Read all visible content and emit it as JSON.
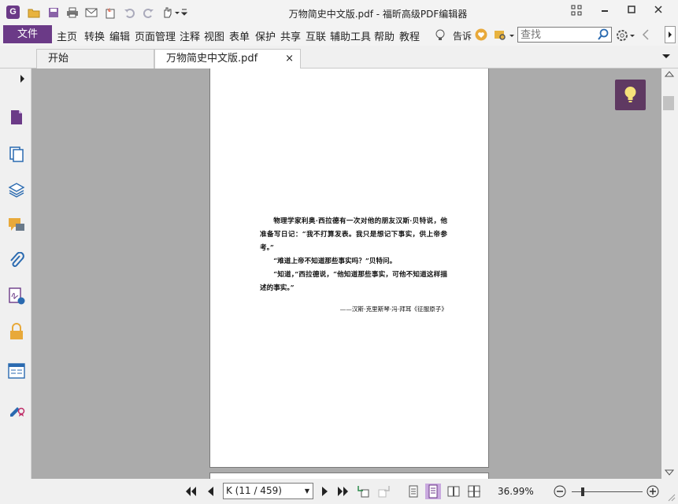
{
  "window": {
    "title": "万物简史中文版.pdf - 福昕高级PDF编辑器",
    "app_logo": "G"
  },
  "icons": {
    "app_logo": "foxit-logo-icon",
    "qat": [
      "open-folder-icon",
      "save-icon",
      "print-icon",
      "email-icon",
      "new-icon",
      "undo-icon",
      "redo-icon",
      "hand-tool-icon"
    ],
    "left_panel": [
      "page-thumbnail-icon",
      "pages-icon",
      "layers-icon",
      "comments-icon",
      "attachments-icon",
      "signature-icon",
      "security-icon",
      "form-fields-icon",
      "certify-icon"
    ]
  },
  "menu": {
    "file": "文件",
    "items": [
      "主页",
      "转换",
      "编辑",
      "页面管理",
      "注释",
      "视图",
      "表单",
      "保护",
      "共享",
      "互联",
      "辅助工具",
      "帮助",
      "教程"
    ],
    "tell_me": "告诉",
    "search_placeholder": "查找"
  },
  "tabs": [
    {
      "label": "开始",
      "active": false
    },
    {
      "label": "万物简史中文版.pdf",
      "active": true,
      "close": "×"
    }
  ],
  "document": {
    "paragraphs": [
      "物理学家利奥·西拉德有一次对他的朋友汉斯·贝特说，他准备写日记：“我不打算发表。我只是想记下事实，供上帝参考。”",
      "“难道上帝不知道那些事实吗？”贝特问。",
      "“知道，”西拉德说，“他知道那些事实，可他不知道这样描述的事实。”"
    ],
    "attribution": "——汉斯·克里斯琴·冯·拜耳《征服原子》"
  },
  "status": {
    "page_indicator": "K (11 / 459)",
    "zoom": "36.99%"
  },
  "colors": {
    "brand": "#6b3a87",
    "bulb_bg": "#5f3962",
    "doc_bg": "#ababab"
  }
}
